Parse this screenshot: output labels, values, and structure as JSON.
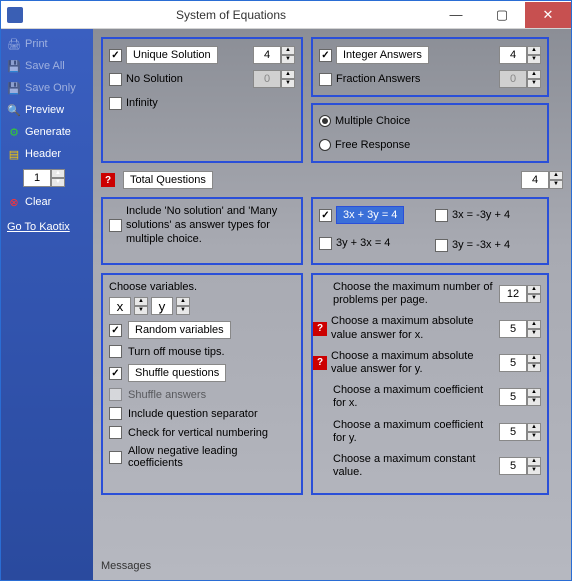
{
  "window": {
    "title": "System of Equations"
  },
  "sidebar": {
    "print": "Print",
    "save_all": "Save All",
    "save_only": "Save Only",
    "preview": "Preview",
    "generate": "Generate",
    "header": "Header",
    "header_value": "1",
    "clear": "Clear",
    "link": "Go To Kaotix"
  },
  "top_left": {
    "unique": "Unique Solution",
    "unique_val": "4",
    "none": "No Solution",
    "none_val": "0",
    "inf": "Infinity"
  },
  "top_right": {
    "int": "Integer Answers",
    "int_val": "4",
    "frac": "Fraction Answers",
    "frac_val": "0"
  },
  "response": {
    "mc": "Multiple Choice",
    "fr": "Free Response"
  },
  "total": {
    "label": "Total Questions",
    "value": "4"
  },
  "include": {
    "text": "Include 'No solution' and 'Many solutions' as answer types for multiple choice."
  },
  "eq": {
    "a": "3x + 3y = 4",
    "b": "3x = -3y + 4",
    "c": "3y + 3x = 4",
    "d": "3y = -3x + 4"
  },
  "vars": {
    "title": "Choose variables.",
    "v1": "x",
    "v2": "y",
    "random": "Random variables",
    "tips": "Turn off mouse tips.",
    "shuffle_q": "Shuffle questions",
    "shuffle_a": "Shuffle answers",
    "sep": "Include question separator",
    "vert": "Check for vertical numbering",
    "neg": "Allow negative leading coefficients"
  },
  "nums": {
    "per_page": "Choose the maximum number of problems per page.",
    "per_page_val": "12",
    "max_x": "Choose a  maximum absolute value answer for x.",
    "max_x_val": "5",
    "max_y": "Choose a  maximum absolute value answer for y.",
    "max_y_val": "5",
    "coef_x": "Choose a maximum coefficient for x.",
    "coef_x_val": "5",
    "coef_y": "Choose a maximum coefficient for y.",
    "coef_y_val": "5",
    "const": "Choose a maximum constant value.",
    "const_val": "5"
  },
  "messages": "Messages"
}
